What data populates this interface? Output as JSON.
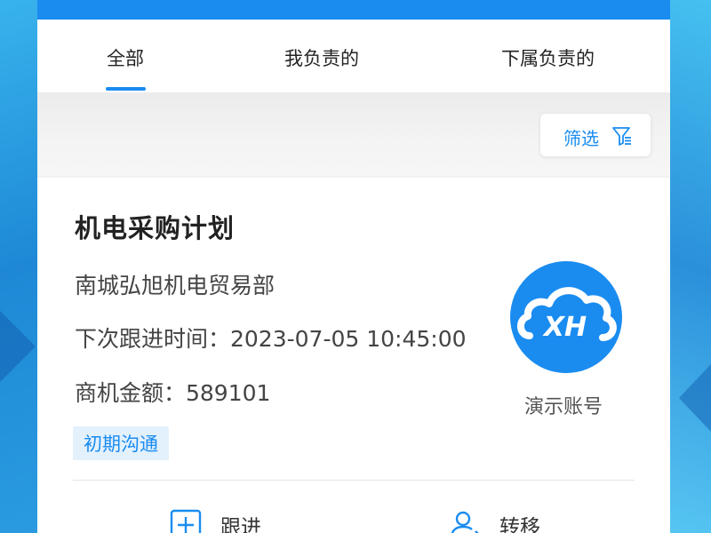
{
  "tabs": [
    {
      "label": "全部"
    },
    {
      "label": "我负责的"
    },
    {
      "label": "下属负责的"
    }
  ],
  "filter": {
    "label": "筛选",
    "icon": "filter-icon"
  },
  "card": {
    "title": "机电采购计划",
    "company": "南城弘旭机电贸易部",
    "next_follow": "下次跟进时间：2023-07-05 10:45:00",
    "amount": "商机金额：589101",
    "stage": "初期沟通",
    "owner": "演示账号",
    "avatar_logo": "XH"
  },
  "actions": [
    {
      "label": "跟进",
      "icon": "plus-square-icon"
    },
    {
      "label": "转移",
      "icon": "user-transfer-icon"
    }
  ],
  "colors": {
    "accent": "#1a8cf0",
    "stage_bg": "#e3f1fd"
  }
}
